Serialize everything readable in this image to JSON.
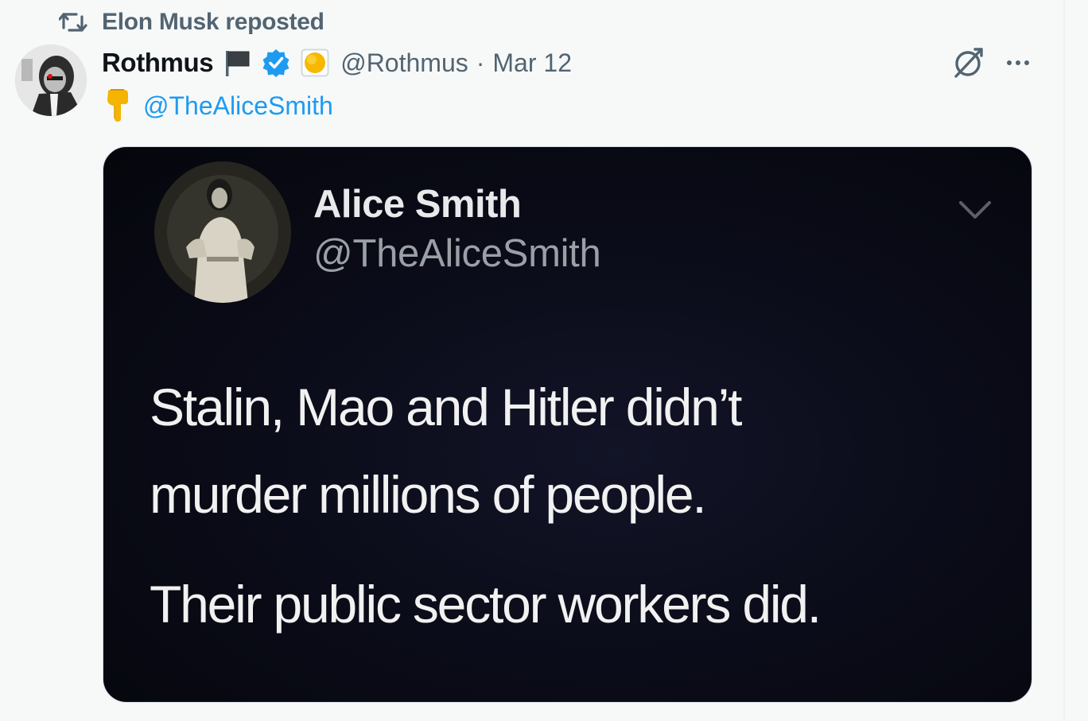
{
  "repost": {
    "text": "Elon Musk reposted",
    "icon": "repost-icon"
  },
  "post": {
    "display_name": "Rothmus",
    "handle": "@Rothmus",
    "separator": "·",
    "date": "Mar 12",
    "verified_color": "#1d9bf0",
    "mention": "@TheAliceSmith",
    "icons": [
      "flag-icon",
      "verified-icon",
      "affiliation-icon",
      "grok-icon",
      "more-icon",
      "pointing-down-icon"
    ]
  },
  "media": {
    "name": "Alice Smith",
    "handle": "@TheAliceSmith",
    "lines": [
      "Stalin, Mao and Hitler didn’t",
      "murder millions of people.",
      "Their public sector workers did."
    ]
  },
  "colors": {
    "background": "#f7f9f9",
    "text_primary": "#0f1419",
    "text_secondary": "#536471",
    "link": "#1d9bf0",
    "media_bg": "#0a0b17"
  }
}
